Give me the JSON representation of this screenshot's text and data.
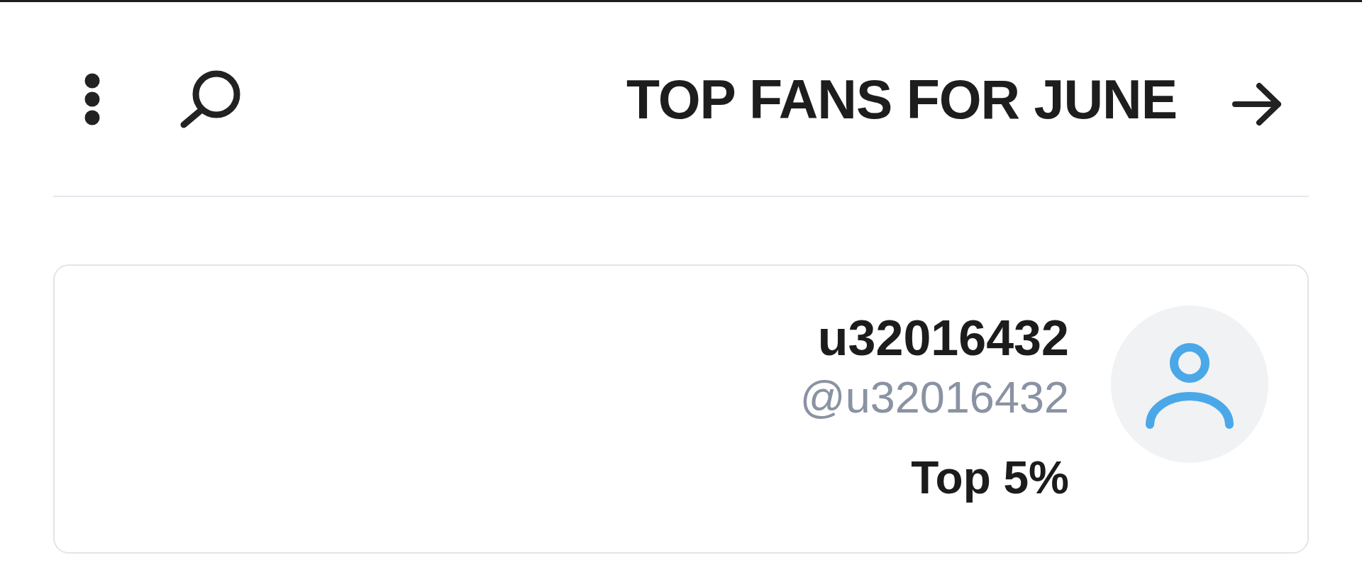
{
  "header": {
    "title": "TOP FANS FOR JUNE"
  },
  "fans": [
    {
      "name": "u32016432",
      "handle": "@u32016432",
      "rank": "Top 5%"
    }
  ]
}
